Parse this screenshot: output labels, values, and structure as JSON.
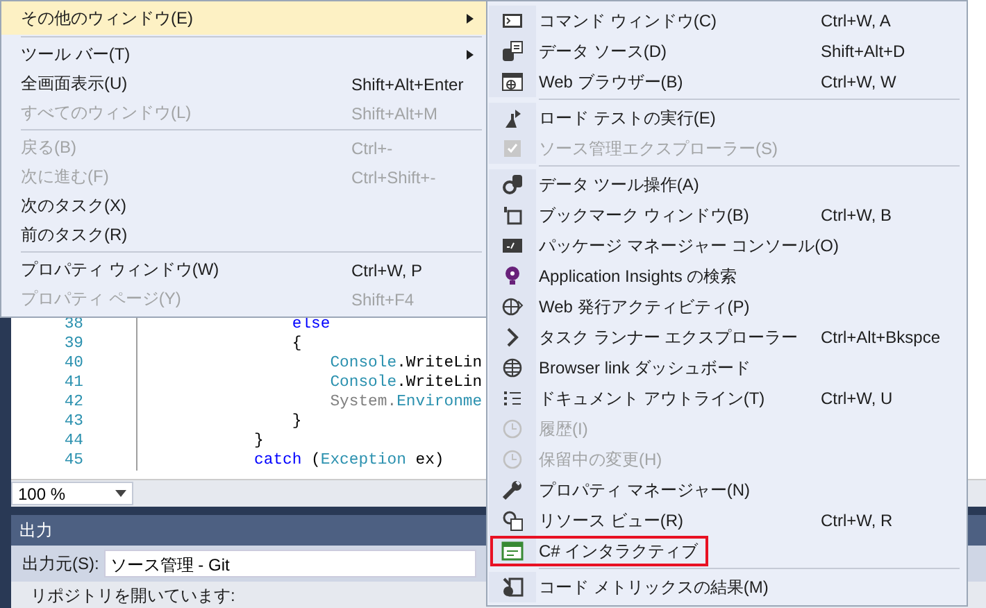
{
  "editor": {
    "lines": [
      {
        "number": "38",
        "tokens": [
          {
            "text": "                else",
            "kind": "keyword"
          }
        ]
      },
      {
        "number": "39",
        "tokens": [
          {
            "text": "                {",
            "kind": "plain"
          }
        ]
      },
      {
        "number": "40",
        "tokens": [
          {
            "text": "                    Console",
            "kind": "type"
          },
          {
            "text": ".WriteLin",
            "kind": "plain"
          }
        ]
      },
      {
        "number": "41",
        "tokens": [
          {
            "text": "                    Console",
            "kind": "type"
          },
          {
            "text": ".WriteLin",
            "kind": "plain"
          }
        ]
      },
      {
        "number": "42",
        "tokens": [
          {
            "text": "                    System.",
            "kind": "muted"
          },
          {
            "text": "Environme",
            "kind": "type"
          }
        ]
      },
      {
        "number": "43",
        "tokens": [
          {
            "text": "                }",
            "kind": "plain"
          }
        ]
      },
      {
        "number": "44",
        "tokens": [
          {
            "text": "            }",
            "kind": "plain"
          }
        ]
      },
      {
        "number": "45",
        "tokens": [
          {
            "text": "            catch",
            "kind": "keyword"
          },
          {
            "text": " (",
            "kind": "plain"
          },
          {
            "text": "Exception",
            "kind": "type"
          },
          {
            "text": " ex)",
            "kind": "plain"
          }
        ]
      }
    ],
    "zoom": "100 %"
  },
  "output": {
    "title": "出力",
    "source_label": "出力元(S):",
    "source_value": "ソース管理 - Git",
    "text": "リポジトリを開いています:"
  },
  "menu": {
    "items": [
      {
        "kind": "item",
        "label": "その他のウィンドウ(E)",
        "submenu": true,
        "disabled": false,
        "selected": true
      },
      {
        "kind": "separator"
      },
      {
        "kind": "item",
        "label": "ツール バー(T)",
        "submenu": true,
        "disabled": false,
        "selected": false
      },
      {
        "kind": "item",
        "label": "全画面表示(U)",
        "shortcut": "Shift+Alt+Enter",
        "submenu": false,
        "disabled": false,
        "selected": false
      },
      {
        "kind": "item",
        "label": "すべてのウィンドウ(L)",
        "shortcut": "Shift+Alt+M",
        "submenu": false,
        "disabled": true,
        "selected": false
      },
      {
        "kind": "separator"
      },
      {
        "kind": "item",
        "label": "戻る(B)",
        "shortcut": "Ctrl+-",
        "submenu": false,
        "disabled": true,
        "selected": false
      },
      {
        "kind": "item",
        "label": "次に進む(F)",
        "shortcut": "Ctrl+Shift+-",
        "submenu": false,
        "disabled": true,
        "selected": false
      },
      {
        "kind": "item",
        "label": "次のタスク(X)",
        "submenu": false,
        "disabled": false,
        "selected": false
      },
      {
        "kind": "item",
        "label": "前のタスク(R)",
        "submenu": false,
        "disabled": false,
        "selected": false
      },
      {
        "kind": "separator"
      },
      {
        "kind": "item",
        "label": "プロパティ ウィンドウ(W)",
        "shortcut": "Ctrl+W, P",
        "submenu": false,
        "disabled": false,
        "selected": false
      },
      {
        "kind": "item",
        "label": "プロパティ ページ(Y)",
        "shortcut": "Shift+F4",
        "submenu": false,
        "disabled": true,
        "selected": false
      }
    ]
  },
  "submenu": {
    "items": [
      {
        "kind": "item",
        "label": "コマンド ウィンドウ(C)",
        "shortcut": "Ctrl+W, A",
        "disabled": false,
        "highlighted": false
      },
      {
        "kind": "item",
        "label": "データ ソース(D)",
        "shortcut": "Shift+Alt+D",
        "disabled": false,
        "highlighted": false
      },
      {
        "kind": "item",
        "label": "Web ブラウザー(B)",
        "shortcut": "Ctrl+W, W",
        "disabled": false,
        "highlighted": false
      },
      {
        "kind": "separator"
      },
      {
        "kind": "item",
        "label": "ロード テストの実行(E)",
        "disabled": false,
        "highlighted": false
      },
      {
        "kind": "item",
        "label": "ソース管理エクスプローラー(S)",
        "disabled": true,
        "highlighted": false
      },
      {
        "kind": "separator"
      },
      {
        "kind": "item",
        "label": "データ ツール操作(A)",
        "disabled": false,
        "highlighted": false
      },
      {
        "kind": "item",
        "label": "ブックマーク ウィンドウ(B)",
        "shortcut": "Ctrl+W, B",
        "disabled": false,
        "highlighted": false
      },
      {
        "kind": "item",
        "label": "パッケージ マネージャー コンソール(O)",
        "disabled": false,
        "highlighted": false
      },
      {
        "kind": "item",
        "label": "Application Insights の検索",
        "disabled": false,
        "highlighted": false
      },
      {
        "kind": "item",
        "label": "Web 発行アクティビティ(P)",
        "disabled": false,
        "highlighted": false
      },
      {
        "kind": "item",
        "label": "タスク ランナー エクスプローラー",
        "shortcut": "Ctrl+Alt+Bkspce",
        "disabled": false,
        "highlighted": false
      },
      {
        "kind": "item",
        "label": "Browser link ダッシュボード",
        "disabled": false,
        "highlighted": false
      },
      {
        "kind": "item",
        "label": "ドキュメント アウトライン(T)",
        "shortcut": "Ctrl+W, U",
        "disabled": false,
        "highlighted": false
      },
      {
        "kind": "item",
        "label": "履歴(I)",
        "disabled": true,
        "highlighted": false
      },
      {
        "kind": "item",
        "label": "保留中の変更(H)",
        "disabled": true,
        "highlighted": false
      },
      {
        "kind": "item",
        "label": "プロパティ マネージャー(N)",
        "disabled": false,
        "highlighted": false
      },
      {
        "kind": "item",
        "label": "リソース ビュー(R)",
        "shortcut": "Ctrl+W, R",
        "disabled": false,
        "highlighted": false
      },
      {
        "kind": "item",
        "label": "C# インタラクティブ",
        "disabled": false,
        "highlighted": true
      },
      {
        "kind": "separator"
      },
      {
        "kind": "item",
        "label": "コード メトリックスの結果(M)",
        "disabled": false,
        "highlighted": false
      }
    ]
  }
}
